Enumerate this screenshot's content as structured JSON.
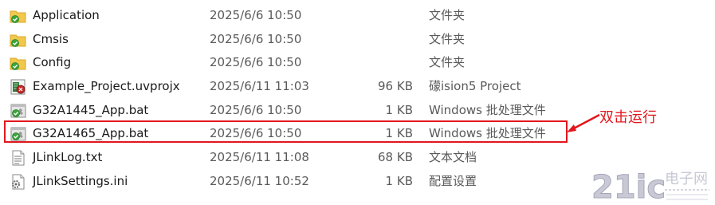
{
  "files": [
    {
      "name": "Application",
      "date": "2025/6/6 10:50",
      "size": "",
      "type": "文件夹",
      "icon": "folder-icon"
    },
    {
      "name": "Cmsis",
      "date": "2025/6/6 10:50",
      "size": "",
      "type": "文件夹",
      "icon": "folder-icon"
    },
    {
      "name": "Config",
      "date": "2025/6/6 10:50",
      "size": "",
      "type": "文件夹",
      "icon": "folder-icon"
    },
    {
      "name": "Example_Project.uvprojx",
      "date": "2025/6/11 11:03",
      "size": "96 KB",
      "type": "礞ision5 Project",
      "icon": "keil-project-icon"
    },
    {
      "name": "G32A1445_App.bat",
      "date": "2025/6/6 10:50",
      "size": "1 KB",
      "type": "Windows 批处理文件",
      "icon": "batch-file-icon"
    },
    {
      "name": "G32A1465_App.bat",
      "date": "2025/6/6 10:50",
      "size": "1 KB",
      "type": "Windows 批处理文件",
      "icon": "batch-file-icon"
    },
    {
      "name": "JLinkLog.txt",
      "date": "2025/6/11 11:08",
      "size": "68 KB",
      "type": "文本文档",
      "icon": "text-file-icon"
    },
    {
      "name": "JLinkSettings.ini",
      "date": "2025/6/11 10:52",
      "size": "1 KB",
      "type": "配置设置",
      "icon": "settings-file-icon"
    }
  ],
  "annotation": {
    "label": "双击运行",
    "color": "#e3161d"
  },
  "watermark": {
    "text": "21ic电子网",
    "color": "#b8b8c8"
  }
}
